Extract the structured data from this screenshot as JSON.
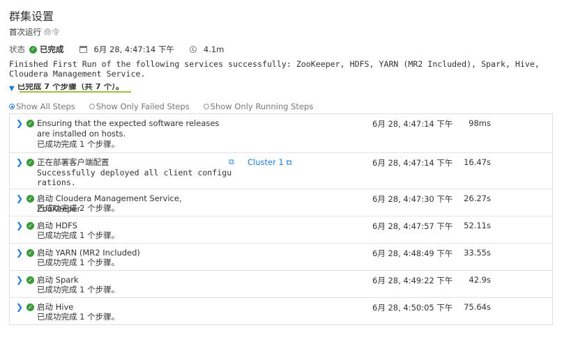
{
  "header": {
    "title": "群集设置",
    "subtitle_prefix": "首次运行",
    "subtitle_muted": "命令"
  },
  "status": {
    "label": "状态",
    "value": "已完成",
    "date": "6月 28, 4:47:14 下午",
    "duration": "4.1m"
  },
  "message": "Finished First Run of the following services successfully: ZooKeeper, HDFS, YARN (MR2 Included), Spark, Hive, Cloudera Management Service.",
  "steps_toggle": "已完成 7 个步骤（共 7 个）。",
  "filters": [
    {
      "label": "Show All Steps",
      "selected": true
    },
    {
      "label": "Show Only Failed Steps",
      "selected": false
    },
    {
      "label": "Show Only Running Steps",
      "selected": false
    }
  ],
  "steps": [
    {
      "title": "Ensuring that the expected software releases are installed on hosts.",
      "summary": "已成功完成 1 个步骤。",
      "time": "6月 28, 4:47:14 下午",
      "duration": "98ms"
    },
    {
      "title": "正在部署客户端配置",
      "message": "Successfully deployed all client configurations.",
      "link": "Cluster 1",
      "time": "6月 28, 4:47:14 下午",
      "duration": "16.47s"
    },
    {
      "title": "启动 Cloudera Management Service, ZooKeeper",
      "summary": "已成功完成 2 个步骤。",
      "time": "6月 28, 4:47:30 下午",
      "duration": "26.27s"
    },
    {
      "title": "启动 HDFS",
      "summary": "已成功完成 1 个步骤。",
      "time": "6月 28, 4:47:57 下午",
      "duration": "52.11s"
    },
    {
      "title": "启动 YARN (MR2 Included)",
      "summary": "已成功完成 1 个步骤。",
      "time": "6月 28, 4:48:49 下午",
      "duration": "33.55s"
    },
    {
      "title": "启动 Spark",
      "summary": "已成功完成 1 个步骤。",
      "time": "6月 28, 4:49:22 下午",
      "duration": "42.9s"
    },
    {
      "title": "启动 Hive",
      "summary": "已成功完成 1 个步骤。",
      "time": "6月 28, 4:50:05 下午",
      "duration": "75.64s"
    }
  ],
  "colors": {
    "accent": "#1a7bd8",
    "success": "#3a9a3a",
    "underline": "#9bc53d"
  }
}
